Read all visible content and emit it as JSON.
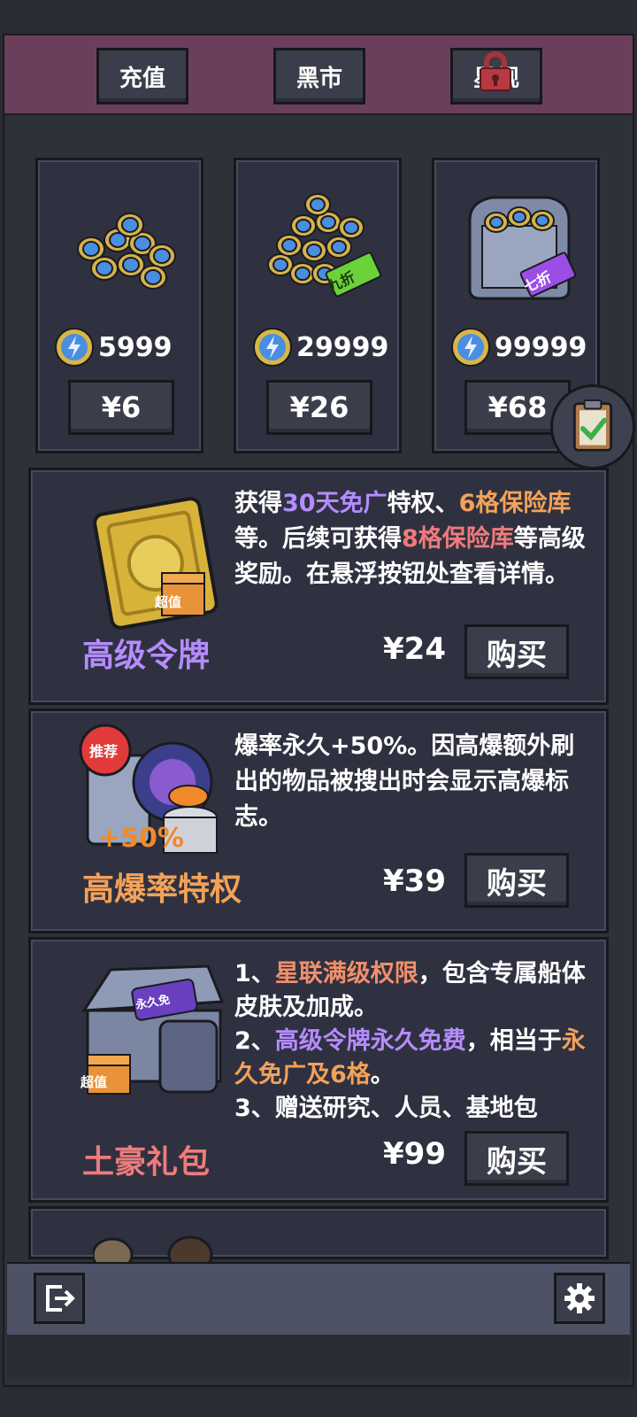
{
  "tabs": [
    {
      "label": "充值"
    },
    {
      "label": "黑市"
    },
    {
      "label": "星舰"
    }
  ],
  "packages": [
    {
      "amount": "5999",
      "price": "¥6"
    },
    {
      "amount": "29999",
      "price": "¥26",
      "badge": "九折"
    },
    {
      "amount": "99999",
      "price": "¥68",
      "badge": "七折"
    }
  ],
  "offers": [
    {
      "title": "高级令牌",
      "price": "¥24",
      "buy": "购买",
      "badge": "超值",
      "desc": {
        "p1": "获得",
        "h1": "30天免广",
        "p2": "特权、",
        "h2": "6格保险库",
        "p3": "等。后续可获得",
        "h3": "8格保险库",
        "p4": "等高级奖励。在悬浮按钮处查看详情。"
      }
    },
    {
      "title": "高爆率特权",
      "price": "¥39",
      "buy": "购买",
      "badge": "推荐",
      "plus": "+50%",
      "desc": {
        "text": "爆率永久+50%。因高爆额外刷出的物品被搜出时会显示高爆标志。"
      }
    },
    {
      "title": "土豪礼包",
      "price": "¥99",
      "buy": "购买",
      "badge": "超值",
      "art_label": "永久免",
      "desc": {
        "l1a": "1、",
        "l1h": "星联满级权限",
        "l1b": "，包含专属船体皮肤及加成。",
        "l2a": "2、",
        "l2h": "高级令牌永久免费",
        "l2b": "，相当于",
        "l2h2": "永久免广及6格",
        "l2c": "。",
        "l3": "3、赠送研究、人员、基地包"
      }
    }
  ],
  "colors": {
    "header": "#6b3f5c",
    "panel": "#2f3140",
    "button": "#3b3e4a",
    "purple": "#b58cff",
    "orange": "#f2a25a",
    "red": "#ef7b7b"
  },
  "icons": [
    "lock-icon",
    "energy-coin-icon",
    "clipboard-check-icon",
    "exit-icon",
    "gear-icon"
  ]
}
